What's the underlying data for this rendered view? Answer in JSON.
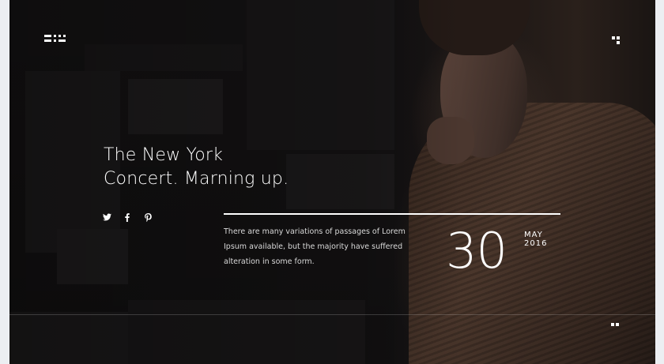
{
  "hero": {
    "title_line1": "The New York",
    "title_line2": "Concert. Marning up.",
    "excerpt": "There are many variations of passages of Lorem Ipsum available, but the majority have suffered alteration in some form.",
    "date": {
      "day": "30",
      "month": "MAY",
      "year": "2016"
    }
  },
  "social": [
    {
      "icon": "twitter-icon",
      "glyph": "🐦"
    },
    {
      "icon": "facebook-icon",
      "glyph": "f"
    },
    {
      "icon": "pinterest-icon",
      "glyph": "ⓟ"
    }
  ],
  "icons": {
    "logo": "logo-icon",
    "menu": "menu-icon",
    "more": "dots-icon"
  },
  "colors": {
    "background": "#121011",
    "text": "#ffffff",
    "muted_text": "#d9d9d9",
    "page_bg": "#eceef2"
  }
}
